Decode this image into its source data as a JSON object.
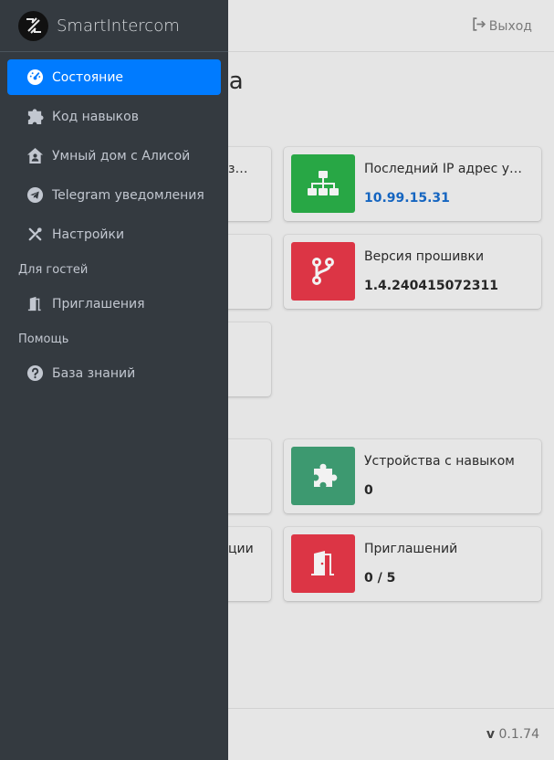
{
  "header": {
    "logout_label": "Выход"
  },
  "main": {
    "title_fragment": "ства",
    "left_cards": [
      {
        "partial_label": "з…"
      },
      {
        "partial_label": ""
      },
      {
        "partial_label": ""
      },
      {
        "partial_label": ""
      },
      {
        "partial_label": "ции"
      }
    ],
    "cards": [
      {
        "label": "Последний IP адрес ус…",
        "value": "10.99.15.31",
        "icon": "network-icon",
        "color": "#28a745"
      },
      {
        "label": "Версия прошивки",
        "value": "1.4.240415072311",
        "icon": "code-branch-icon",
        "color": "#dc3545"
      },
      {
        "label": "Устройства с навыком",
        "value": "0",
        "icon": "puzzle-icon",
        "color": "#3d9970"
      },
      {
        "label": "Приглашений",
        "value": "0 / 5",
        "icon": "door-icon",
        "color": "#dc3545"
      }
    ]
  },
  "footer": {
    "version_prefix": "v",
    "version_number": "0.1.74"
  },
  "sidebar": {
    "brand": "SmartIntercom",
    "items": [
      {
        "label": "Состояние",
        "icon": "dashboard-icon",
        "active": true
      },
      {
        "label": "Код навыков",
        "icon": "puzzle-icon"
      },
      {
        "label": "Умный дом с Алисой",
        "icon": "house-user-icon"
      },
      {
        "label": "Telegram уведомления",
        "icon": "telegram-icon"
      },
      {
        "label": "Настройки",
        "icon": "tools-icon"
      }
    ],
    "guests_header": "Для гостей",
    "guest_items": [
      {
        "label": "Приглашения",
        "icon": "door-icon"
      }
    ],
    "help_header": "Помощь",
    "help_items": [
      {
        "label": "База знаний",
        "icon": "question-circle-icon"
      }
    ]
  },
  "colors": {
    "sidebar_bg": "#343a40",
    "active": "#007bff",
    "link": "#1565c0"
  }
}
